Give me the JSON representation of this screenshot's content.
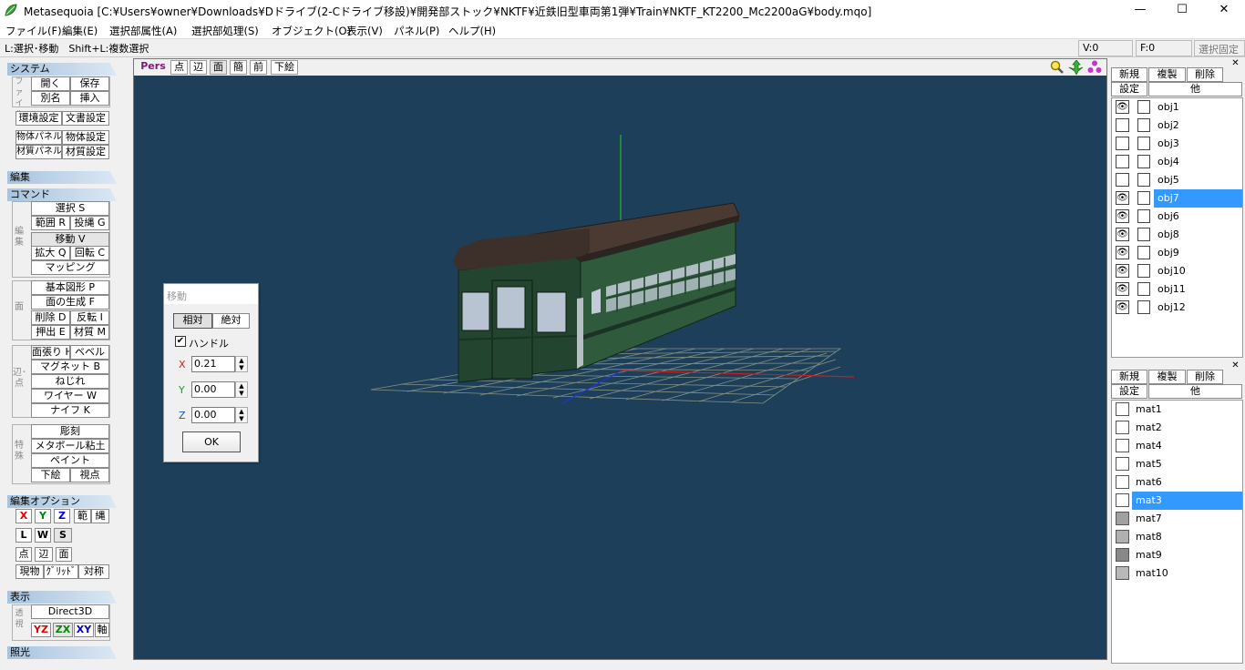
{
  "window": {
    "title": "Metasequoia [C:¥Users¥owner¥Downloads¥Dドライブ(2-Cドライブ移設)¥開発部ストック¥NKTF¥近鉄旧型車両第1弾¥Train¥NKTF_KT2200_Mc2200aG¥body.mqo]",
    "min": "—",
    "max": "☐",
    "close": "✕"
  },
  "menu": [
    "ファイル(F)",
    "編集(E)",
    "選択部属性(A)",
    "選択部処理(S)",
    "オブジェクト(O)",
    "表示(V)",
    "パネル(P)",
    "ヘルプ(H)"
  ],
  "status": {
    "hint": "L:選択･移動　Shift+L:複数選択",
    "v": "V:0",
    "f": "F:0",
    "lock": "選択固定"
  },
  "left": {
    "system_hdr": "システム",
    "file_label": "ファイル",
    "open": "開く",
    "save": "保存",
    "saveas": "別名",
    "insert": "挿入",
    "env": "環境設定",
    "doc": "文書設定",
    "objpanel": "物体パネル",
    "objset": "物体設定",
    "matpanel": "材質パネル",
    "matset": "材質設定",
    "edit_hdr": "編集",
    "cmd_hdr": "コマンド",
    "edit_label": "編集",
    "select": "選択 S",
    "range": "範囲 R",
    "lasso": "投縄 G",
    "move": "移動 V",
    "scale": "拡大 Q",
    "rotate": "回転 C",
    "mapping": "マッピング",
    "face_label": "面",
    "primitive": "基本図形 P",
    "facegen": "面の生成 F",
    "delete": "削除 D",
    "flip": "反転 I",
    "extrude": "押出 E",
    "material": "材質 M",
    "edge_label": "辺･点",
    "facestretch": "面張り H",
    "bevel": "ベベル",
    "magnet": "マグネット B",
    "twist": "ねじれ",
    "wire": "ワイヤー W",
    "knife": "ナイフ K",
    "special_label": "特殊",
    "sculpt": "彫刻",
    "metaball": "メタボール粘土",
    "paint": "ペイント",
    "underlay": "下絵",
    "viewpt": "視点",
    "opt_hdr": "編集オプション",
    "x": "X",
    "y": "Y",
    "z": "Z",
    "han": "範",
    "nawa": "縄",
    "l": "L",
    "w": "W",
    "s": "S",
    "ten": "点",
    "hen": "辺",
    "men": "面",
    "genbutsu": "現物",
    "grid": "ｸﾞﾘｯﾄﾞ",
    "taisho": "対称",
    "view_hdr": "表示",
    "persp_label": "透視",
    "d3d": "Direct3D",
    "yz": "YZ",
    "zx": "ZX",
    "xy": "XY",
    "axis": "軸",
    "light_hdr": "照光"
  },
  "viewport": {
    "tabs": [
      "Pers",
      "点",
      "辺",
      "面",
      "簡",
      "前",
      "下絵"
    ]
  },
  "move_dialog": {
    "title": "移動",
    "relative": "相対",
    "absolute": "絶対",
    "handle": "ハンドル",
    "x_label": "X",
    "x": "0.21",
    "y_label": "Y",
    "y": "0.00",
    "z_label": "Z",
    "z": "0.00",
    "ok": "OK"
  },
  "objects": {
    "new": "新規",
    "dup": "複製",
    "del": "削除",
    "set": "設定",
    "other": "他",
    "items": [
      {
        "name": "obj1",
        "visible": true,
        "selected": false
      },
      {
        "name": "obj2",
        "visible": false,
        "selected": false
      },
      {
        "name": "obj3",
        "visible": false,
        "selected": false
      },
      {
        "name": "obj4",
        "visible": false,
        "selected": false
      },
      {
        "name": "obj5",
        "visible": false,
        "selected": false
      },
      {
        "name": "obj7",
        "visible": true,
        "selected": true
      },
      {
        "name": "obj6",
        "visible": true,
        "selected": false
      },
      {
        "name": "obj8",
        "visible": true,
        "selected": false
      },
      {
        "name": "obj9",
        "visible": true,
        "selected": false
      },
      {
        "name": "obj10",
        "visible": true,
        "selected": false
      },
      {
        "name": "obj11",
        "visible": true,
        "selected": false
      },
      {
        "name": "obj12",
        "visible": true,
        "selected": false
      }
    ]
  },
  "materials": {
    "new": "新規",
    "dup": "複製",
    "del": "削除",
    "set": "設定",
    "other": "他",
    "items": [
      {
        "name": "mat1",
        "color": "#ffffff",
        "selected": false
      },
      {
        "name": "mat2",
        "color": "#ffffff",
        "selected": false
      },
      {
        "name": "mat4",
        "color": "#ffffff",
        "selected": false
      },
      {
        "name": "mat5",
        "color": "#ffffff",
        "selected": false
      },
      {
        "name": "mat6",
        "color": "#ffffff",
        "selected": false
      },
      {
        "name": "mat3",
        "color": "#ffffff",
        "selected": true
      },
      {
        "name": "mat7",
        "color": "#a0a0a0",
        "selected": false
      },
      {
        "name": "mat8",
        "color": "#b0b0b0",
        "selected": false
      },
      {
        "name": "mat9",
        "color": "#888888",
        "selected": false
      },
      {
        "name": "mat10",
        "color": "#b8b8b8",
        "selected": false
      }
    ]
  }
}
